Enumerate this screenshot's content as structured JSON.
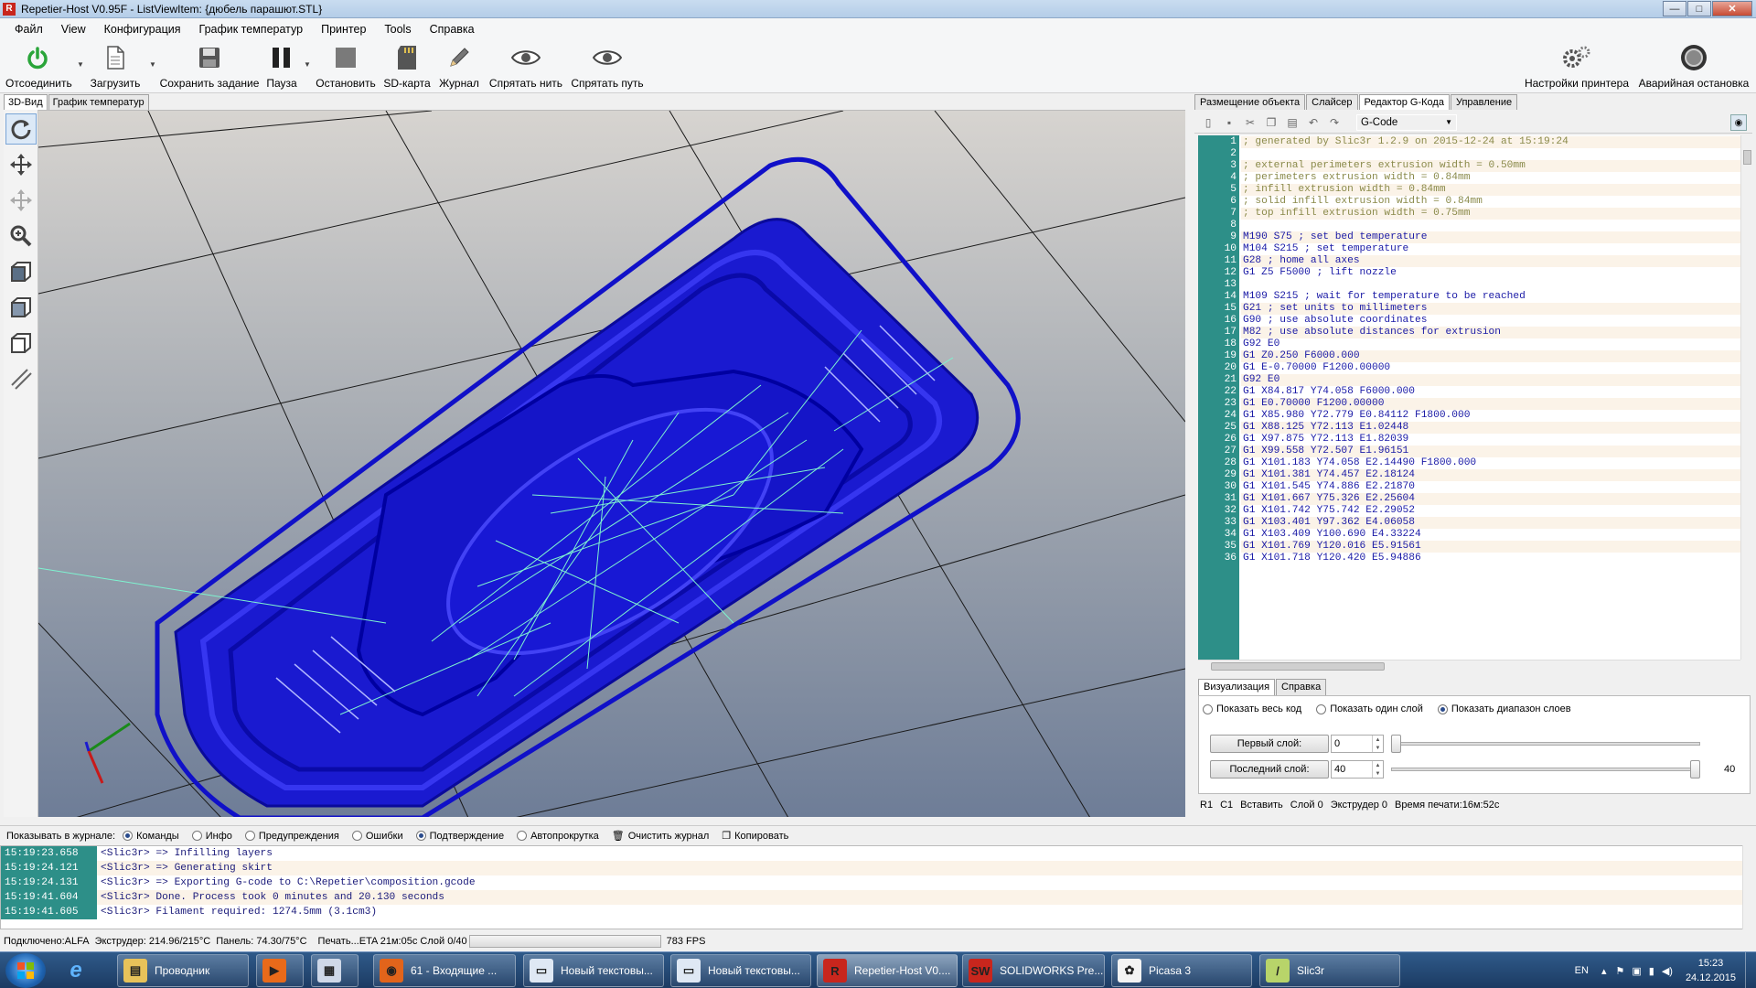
{
  "window": {
    "title": "Repetier-Host V0.95F - ListViewItem: {дюбель парашют.STL}",
    "app_icon": "R",
    "minimize": "—",
    "maximize": "□",
    "close": "✕"
  },
  "menu": [
    "Файл",
    "View",
    "Конфигурация",
    "График температур",
    "Принтер",
    "Tools",
    "Справка"
  ],
  "toolbar": {
    "disconnect": "Отсоединить",
    "load": "Загрузить",
    "save_job": "Сохранить задание",
    "pause": "Пауза",
    "stop": "Остановить",
    "sdcard": "SD-карта",
    "log": "Журнал",
    "hide_filament": "Спрятать нить",
    "hide_path": "Спрятать путь",
    "printer_settings": "Настройки принтера",
    "emergency_stop": "Аварийная остановка"
  },
  "left_tabs": [
    "3D-Вид",
    "График температур"
  ],
  "right_tabs": [
    "Размещение объекта",
    "Слайсер",
    "Редактор G-Кода",
    "Управление"
  ],
  "editor": {
    "mode_select": "G-Code",
    "lines": [
      {
        "n": "1",
        "t": "; generated by Slic3r 1.2.9 on 2015-12-24 at 15:19:24"
      },
      {
        "n": "2",
        "t": ""
      },
      {
        "n": "3",
        "t": "; external perimeters extrusion width = 0.50mm"
      },
      {
        "n": "4",
        "t": "; perimeters extrusion width = 0.84mm"
      },
      {
        "n": "5",
        "t": "; infill extrusion width = 0.84mm"
      },
      {
        "n": "6",
        "t": "; solid infill extrusion width = 0.84mm"
      },
      {
        "n": "7",
        "t": "; top infill extrusion width = 0.75mm"
      },
      {
        "n": "8",
        "t": ""
      },
      {
        "n": "9",
        "t": "M190 S75 ; set bed temperature"
      },
      {
        "n": "10",
        "t": "M104 S215 ; set temperature"
      },
      {
        "n": "11",
        "t": "G28 ; home all axes"
      },
      {
        "n": "12",
        "t": "G1 Z5 F5000 ; lift nozzle"
      },
      {
        "n": "13",
        "t": ""
      },
      {
        "n": "14",
        "t": "M109 S215 ; wait for temperature to be reached"
      },
      {
        "n": "15",
        "t": "G21 ; set units to millimeters"
      },
      {
        "n": "16",
        "t": "G90 ; use absolute coordinates"
      },
      {
        "n": "17",
        "t": "M82 ; use absolute distances for extrusion"
      },
      {
        "n": "18",
        "t": "G92 E0"
      },
      {
        "n": "19",
        "t": "G1 Z0.250 F6000.000"
      },
      {
        "n": "20",
        "t": "G1 E-0.70000 F1200.00000"
      },
      {
        "n": "21",
        "t": "G92 E0"
      },
      {
        "n": "22",
        "t": "G1 X84.817 Y74.058 F6000.000"
      },
      {
        "n": "23",
        "t": "G1 E0.70000 F1200.00000"
      },
      {
        "n": "24",
        "t": "G1 X85.980 Y72.779 E0.84112 F1800.000"
      },
      {
        "n": "25",
        "t": "G1 X88.125 Y72.113 E1.02448"
      },
      {
        "n": "26",
        "t": "G1 X97.875 Y72.113 E1.82039"
      },
      {
        "n": "27",
        "t": "G1 X99.558 Y72.507 E1.96151"
      },
      {
        "n": "28",
        "t": "G1 X101.183 Y74.058 E2.14490 F1800.000"
      },
      {
        "n": "29",
        "t": "G1 X101.381 Y74.457 E2.18124"
      },
      {
        "n": "30",
        "t": "G1 X101.545 Y74.886 E2.21870"
      },
      {
        "n": "31",
        "t": "G1 X101.667 Y75.326 E2.25604"
      },
      {
        "n": "32",
        "t": "G1 X101.742 Y75.742 E2.29052"
      },
      {
        "n": "33",
        "t": "G1 X103.401 Y97.362 E4.06058"
      },
      {
        "n": "34",
        "t": "G1 X103.409 Y100.690 E4.33224"
      },
      {
        "n": "35",
        "t": "G1 X101.769 Y120.016 E5.91561"
      },
      {
        "n": "36",
        "t": "G1 X101.718 Y120.420 E5.94886"
      }
    ]
  },
  "vis": {
    "tabs": [
      "Визуализация",
      "Справка"
    ],
    "show_all": "Показать весь код",
    "show_one": "Показать один слой",
    "show_range": "Показать диапазон слоев",
    "first_layer_label": "Первый слой:",
    "first_layer_value": "0",
    "last_layer_label": "Последний слой:",
    "last_layer_value": "40",
    "slider_max": "40"
  },
  "editor_status": [
    "R1",
    "C1",
    "Вставить",
    "Слой 0",
    "Экструдер 0",
    "Время печати:16м:52с"
  ],
  "logbar": {
    "label": "Показывать в журнале:",
    "commands": "Команды",
    "info": "Инфо",
    "warnings": "Предупреждения",
    "errors": "Ошибки",
    "confirm": "Подтверждение",
    "autoscroll": "Автопрокрутка",
    "clear": "Очистить журнал",
    "copy": "Копировать"
  },
  "log": [
    {
      "t": "15:19:23.658",
      "m": "<Slic3r> => Infilling layers"
    },
    {
      "t": "15:19:24.121",
      "m": "<Slic3r> => Generating skirt"
    },
    {
      "t": "15:19:24.131",
      "m": "<Slic3r> => Exporting G-code to C:\\Repetier\\composition.gcode"
    },
    {
      "t": "15:19:41.604",
      "m": "<Slic3r> Done. Process took 0 minutes and 20.130 seconds"
    },
    {
      "t": "15:19:41.605",
      "m": "<Slic3r> Filament required: 1274.5mm (3.1cm3)"
    }
  ],
  "status": {
    "connected": "Подключено:ALFA",
    "extruder": "Экструдер: 214.96/215°C",
    "bed": "Панель: 74.30/75°C",
    "print": "Печать...ETA 21м:05с Слой 0/40",
    "progress": 0,
    "fps": "783 FPS"
  },
  "taskbar": [
    {
      "label": "Проводник",
      "icon_color": "#e8c25a",
      "glyph": "▤"
    },
    {
      "label": "",
      "icon_color": "#e86a1a",
      "glyph": "▶"
    },
    {
      "label": "",
      "icon_color": "#cfd8e8",
      "glyph": "▦"
    },
    {
      "label": "61 - Входящие ...",
      "icon_color": "#e2641b",
      "glyph": "◉"
    },
    {
      "label": "Новый текстовы...",
      "icon_color": "#dfe8f4",
      "glyph": "▭"
    },
    {
      "label": "Новый текстовы...",
      "icon_color": "#dfe8f4",
      "glyph": "▭"
    },
    {
      "label": "Repetier-Host V0....",
      "icon_color": "#c8261d",
      "glyph": "R"
    },
    {
      "label": "SOLIDWORKS Pre...",
      "icon_color": "#c8261d",
      "glyph": "SW"
    },
    {
      "label": "Picasa 3",
      "icon_color": "#f3f3f3",
      "glyph": "✿"
    },
    {
      "label": "Slic3r",
      "icon_color": "#b8d46a",
      "glyph": "/"
    }
  ],
  "tray": {
    "lang": "EN",
    "time": "15:23",
    "date": "24.12.2015"
  }
}
